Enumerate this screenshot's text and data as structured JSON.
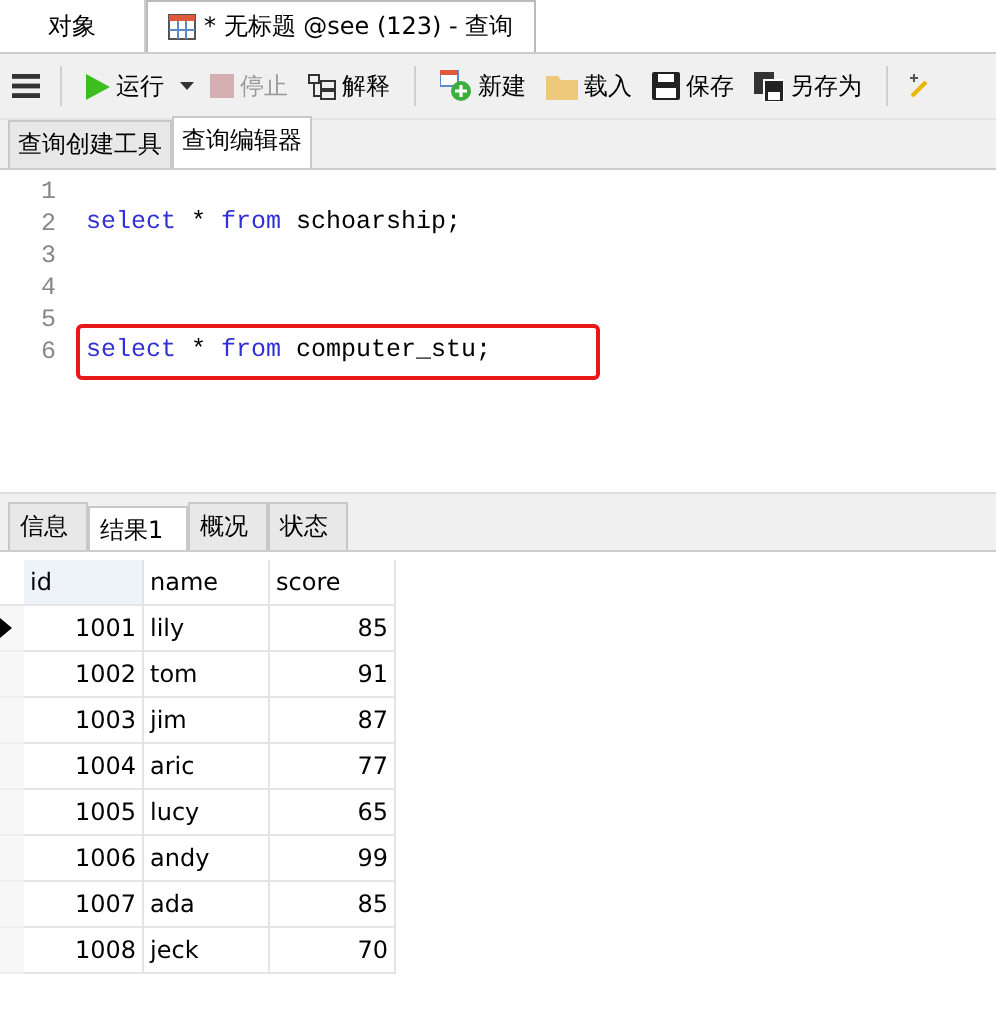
{
  "doc_tabs": [
    {
      "label": "对象",
      "selected": false,
      "kind": "plain"
    },
    {
      "label": "* 无标题 @see (123) - 查询",
      "selected": true,
      "kind": "query"
    }
  ],
  "toolbar": [
    {
      "kind": "menu"
    },
    {
      "kind": "run",
      "label": "运行",
      "disabled": false
    },
    {
      "kind": "stop",
      "label": "停止",
      "disabled": true
    },
    {
      "kind": "explain",
      "label": "解释",
      "disabled": false
    },
    {
      "kind": "new",
      "label": "新建",
      "disabled": false
    },
    {
      "kind": "load",
      "label": "载入",
      "disabled": false
    },
    {
      "kind": "save",
      "label": "保存",
      "disabled": false
    },
    {
      "kind": "saveas",
      "label": "另存为",
      "disabled": false
    },
    {
      "kind": "beautify"
    }
  ],
  "editor_tabs": [
    {
      "label": "查询创建工具",
      "selected": false
    },
    {
      "label": "查询编辑器",
      "selected": true
    }
  ],
  "editor": {
    "lines": [
      {
        "number": "1"
      },
      {
        "number": "2",
        "highlighted": false,
        "tokens": [
          {
            "kind": "keyword",
            "text": "select"
          },
          {
            "kind": "plain",
            "text": "*"
          },
          {
            "kind": "keyword",
            "text": "from"
          },
          {
            "kind": "plain",
            "text": "schoarship;"
          }
        ]
      },
      {
        "number": "3"
      },
      {
        "number": "4"
      },
      {
        "number": "5"
      },
      {
        "number": "6",
        "highlighted": true,
        "tokens": [
          {
            "kind": "keyword",
            "text": "select"
          },
          {
            "kind": "plain",
            "text": "*"
          },
          {
            "kind": "keyword",
            "text": "from"
          },
          {
            "kind": "plain",
            "text": "computer_stu;"
          }
        ]
      }
    ]
  },
  "result_tabs": [
    {
      "label": "信息",
      "selected": false
    },
    {
      "label": "结果1",
      "selected": true
    },
    {
      "label": "概况",
      "selected": false
    },
    {
      "label": "状态",
      "selected": false
    }
  ],
  "table": {
    "columns": [
      "id",
      "name",
      "score"
    ],
    "rows": [
      {
        "cells": [
          "1001",
          "lily",
          "85"
        ],
        "selected": true
      },
      {
        "cells": [
          "1002",
          "tom",
          "91"
        ],
        "selected": false
      },
      {
        "cells": [
          "1003",
          "jim",
          "87"
        ],
        "selected": false
      },
      {
        "cells": [
          "1004",
          "aric",
          "77"
        ],
        "selected": false
      },
      {
        "cells": [
          "1005",
          "lucy",
          "65"
        ],
        "selected": false
      },
      {
        "cells": [
          "1006",
          "andy",
          "99"
        ],
        "selected": false
      },
      {
        "cells": [
          "1007",
          "ada",
          "85"
        ],
        "selected": false
      },
      {
        "cells": [
          "1008",
          "jeck",
          "70"
        ],
        "selected": false
      }
    ]
  }
}
